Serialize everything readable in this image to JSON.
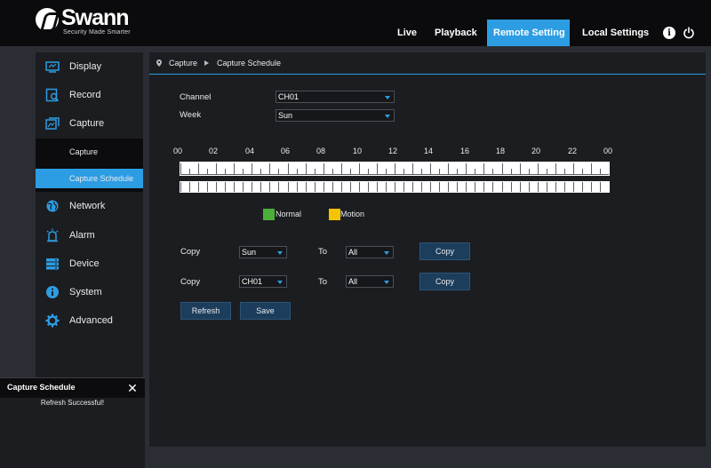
{
  "header": {
    "brand": "Swann",
    "tagline": "Security Made Smarter",
    "tabs": [
      "Live",
      "Playback",
      "Remote Setting",
      "Local Settings"
    ],
    "active_tab": "Remote Setting"
  },
  "sidebar": {
    "items": [
      {
        "label": "Display",
        "icon": "display-icon"
      },
      {
        "label": "Record",
        "icon": "record-icon"
      },
      {
        "label": "Capture",
        "icon": "capture-icon"
      },
      {
        "label": "Network",
        "icon": "network-icon"
      },
      {
        "label": "Alarm",
        "icon": "alarm-icon"
      },
      {
        "label": "Device",
        "icon": "device-icon"
      },
      {
        "label": "System",
        "icon": "system-icon"
      },
      {
        "label": "Advanced",
        "icon": "advanced-icon"
      }
    ],
    "sub_items": [
      {
        "label": "Capture"
      },
      {
        "label": "Capture Schedule"
      }
    ],
    "active_sub": "Capture Schedule"
  },
  "breadcrumb": {
    "level1": "Capture",
    "level2": "Capture Schedule"
  },
  "form": {
    "channel_label": "Channel",
    "channel_value": "CH01",
    "week_label": "Week",
    "week_value": "Sun"
  },
  "schedule": {
    "hour_labels": [
      "00",
      "02",
      "04",
      "06",
      "08",
      "10",
      "12",
      "14",
      "16",
      "18",
      "20",
      "22",
      "00"
    ]
  },
  "legend": {
    "normal_label": "Normal",
    "normal_color": "#4caf3a",
    "motion_label": "Motion",
    "motion_color": "#f5c400"
  },
  "copy_rows": [
    {
      "copy_label": "Copy",
      "from_value": "Sun",
      "to_label": "To",
      "to_value": "All",
      "button": "Copy"
    },
    {
      "copy_label": "Copy",
      "from_value": "CH01",
      "to_label": "To",
      "to_value": "All",
      "button": "Copy"
    }
  ],
  "actions": {
    "refresh": "Refresh",
    "save": "Save"
  },
  "notification": {
    "title": "Capture Schedule",
    "message": "Refresh Successful!"
  },
  "colors": {
    "accent": "#2d9de3",
    "topbar": "#0b0b0d",
    "panel": "#1c1d21",
    "background": "#2a2d33"
  }
}
